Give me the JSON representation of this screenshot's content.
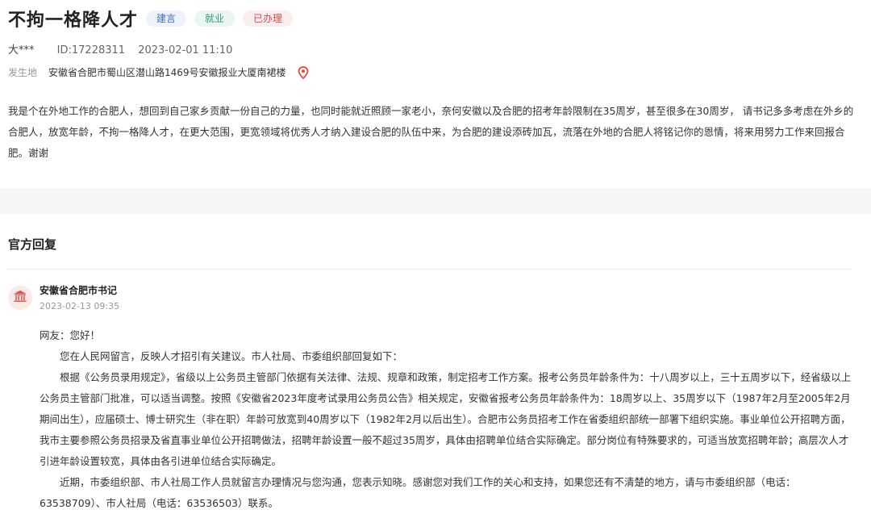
{
  "header": {
    "title": "不拘一格降人才",
    "tags": [
      {
        "label": "建言"
      },
      {
        "label": "就业"
      },
      {
        "label": "已办理"
      }
    ],
    "author": "大***",
    "id_text": "ID:17228311",
    "datetime": "2023-02-01 11:10",
    "location_label": "发生地",
    "location": "安徽省合肥市蜀山区潜山路1469号安徽报业大厦南裙楼"
  },
  "message": "我是个在外地工作的合肥人，想回到自己家乡贡献一份自己的力量，也同时能就近照顾一家老小，奈何安徽以及合肥的招考年龄限制在35周岁，甚至很多在30周岁， 请书记多多考虑在外乡的合肥人，放宽年龄，不拘一格降人才，在更大范围，更宽领域将优秀人才纳入建设合肥的队伍中来，为合肥的建设添砖加瓦，流落在外地的合肥人将铭记你的恩情，将来用努力工作来回报合肥。谢谢",
  "official": {
    "section_title": "官方回复",
    "org_name": "安徽省合肥市书记",
    "reply_time": "2023-02-13 09:35",
    "paragraphs": [
      "网友：您好！",
      "您在人民网留言，反映人才招引有关建议。市人社局、市委组织部回复如下：",
      "根据《公务员录用规定》，省级以上公务员主管部门依据有关法律、法规、规章和政策，制定招考工作方案。报考公务员年龄条件为：十八周岁以上，三十五周岁以下，经省级以上公务员主管部门批准，可以适当调整。按照《安徽省2023年度考试录用公务员公告》相关规定，安徽省报考公务员年龄条件为：18周岁以上、35周岁以下（1987年2月至2005年2月期间出生），应届硕士、博士研究生（非在职）年龄可放宽到40周岁以下（1982年2月以后出生）。合肥市公务员招考工作在省委组织部统一部署下组织实施。事业单位公开招聘方面，我市主要参照公务员招录及省直事业单位公开招聘做法，招聘年龄设置一般不超过35周岁，具体由招聘单位结合实际确定。部分岗位有特殊要求的，可适当放宽招聘年龄；高层次人才引进年龄设置较宽，具体由各引进单位结合实际确定。",
      "近期，市委组织部、市人社局工作人员就留言办理情况与您沟通，您表示知晓。感谢您对我们工作的关心和支持，如果您还有不清楚的地方，请与市委组织部（电话：63538709）、市人社局（电话：63536503）联系。"
    ]
  },
  "colors": {
    "tag_blue": "#3a6fc6",
    "tag_green": "#2f9a78",
    "tag_red": "#e04a4a",
    "pin": "#e24a3b",
    "avatar_icon": "#d9534f"
  },
  "icons": {
    "location": "location-pin-icon",
    "org_avatar": "government-building-icon"
  }
}
